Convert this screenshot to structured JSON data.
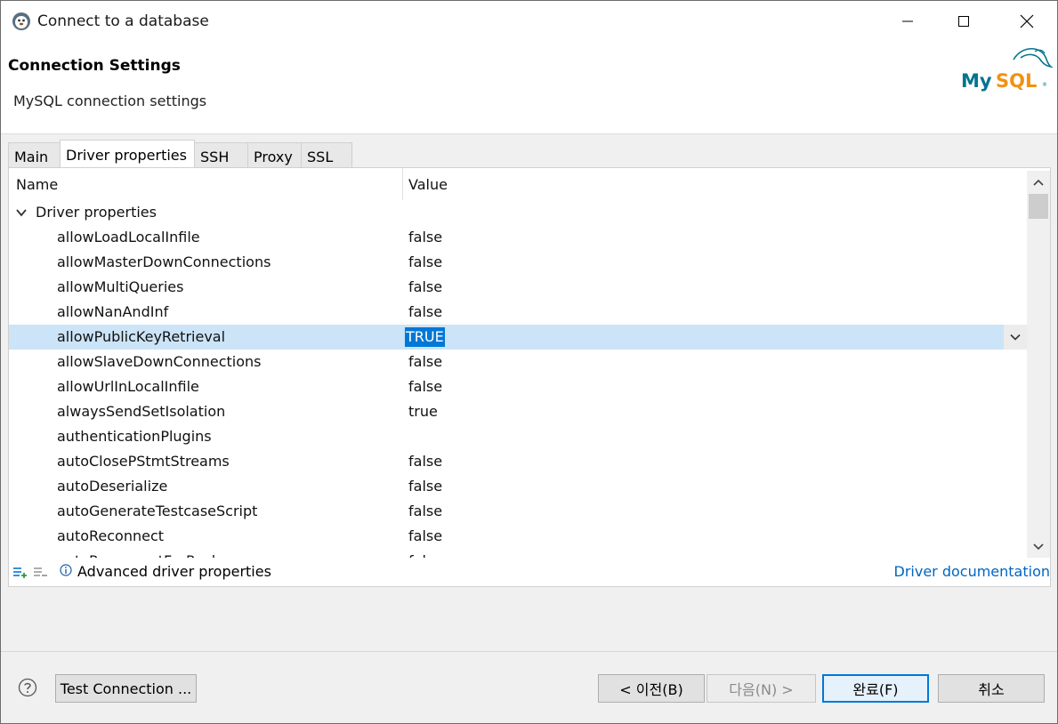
{
  "window": {
    "title": "Connect to a database"
  },
  "header": {
    "section_title": "Connection Settings",
    "section_desc": "MySQL connection settings",
    "logo_text": "MySQL"
  },
  "tabs": [
    {
      "label": "Main",
      "active": false
    },
    {
      "label": "Driver properties",
      "active": true
    },
    {
      "label": "SSH",
      "active": false
    },
    {
      "label": "Proxy",
      "active": false
    },
    {
      "label": "SSL",
      "active": false
    }
  ],
  "table": {
    "col_name": "Name",
    "col_value": "Value",
    "group": "Driver properties",
    "rows": [
      {
        "name": "allowLoadLocalInfile",
        "value": "false"
      },
      {
        "name": "allowMasterDownConnections",
        "value": "false"
      },
      {
        "name": "allowMultiQueries",
        "value": "false"
      },
      {
        "name": "allowNanAndInf",
        "value": "false"
      },
      {
        "name": "allowPublicKeyRetrieval",
        "value": "TRUE"
      },
      {
        "name": "allowSlaveDownConnections",
        "value": "false"
      },
      {
        "name": "allowUrlInLocalInfile",
        "value": "false"
      },
      {
        "name": "alwaysSendSetIsolation",
        "value": "true"
      },
      {
        "name": "authenticationPlugins",
        "value": ""
      },
      {
        "name": "autoClosePStmtStreams",
        "value": "false"
      },
      {
        "name": "autoDeserialize",
        "value": "false"
      },
      {
        "name": "autoGenerateTestcaseScript",
        "value": "false"
      },
      {
        "name": "autoReconnect",
        "value": "false"
      },
      {
        "name": "autoReconnectForPools",
        "value": "false"
      }
    ]
  },
  "footer": {
    "advanced_label": "Advanced driver properties",
    "doc_link": "Driver documentation"
  },
  "buttons": {
    "test_connection": "Test Connection ...",
    "back": "< 이전(B)",
    "next": "다음(N) >",
    "finish": "완료(F)",
    "cancel": "취소"
  },
  "colors": {
    "selection": "#cce4f7",
    "highlight": "#0078d7",
    "link": "#0066bf",
    "mysql_teal": "#00758f",
    "mysql_orange": "#f29111"
  }
}
